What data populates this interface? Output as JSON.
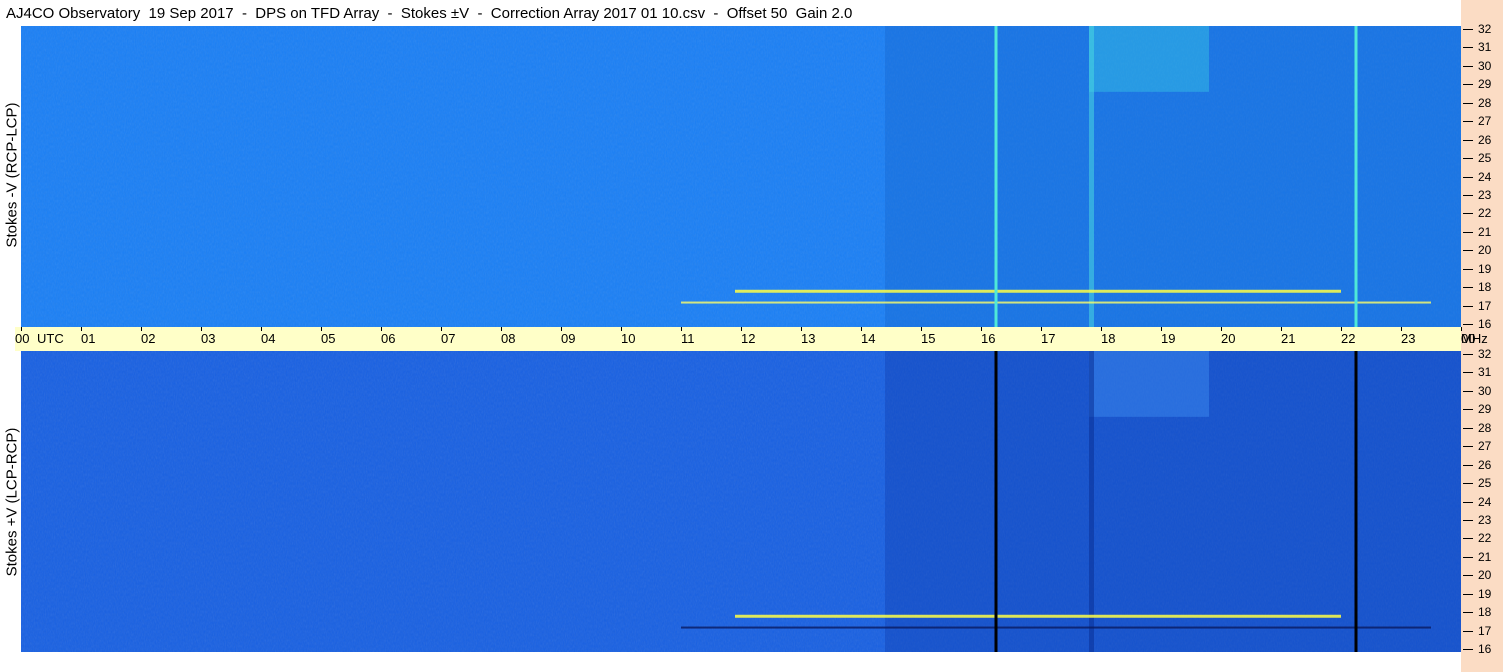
{
  "title": "AJ4CO Observatory  19 Sep 2017  -  DPS on TFD Array  -  Stokes ±V  -  Correction Array 2017 01 10.csv  -  Offset 50  Gain 2.0",
  "chart_data": [
    {
      "type": "heatmap",
      "name": "Stokes -V (RCP-LCP)",
      "ylabel": "Stokes -V (RCP-LCP)",
      "x_axis": "UTC",
      "y_axis_unit": "MHz",
      "xlim": [
        0,
        24
      ],
      "ylim": [
        16,
        32
      ],
      "colors": {
        "background": "#1a7ff5",
        "bright": "#ffff44",
        "streak": "#4fe8d8"
      },
      "vertical_streaks_utc": [
        16.25,
        22.25
      ],
      "bright_band_utc": [
        11.9,
        22.0
      ],
      "bright_band_mhz": 17.9
    },
    {
      "type": "heatmap",
      "name": "Stokes +V (LCP-RCP)",
      "ylabel": "Stokes +V (LCP-RCP)",
      "x_axis": "UTC",
      "y_axis_unit": "MHz",
      "xlim": [
        0,
        24
      ],
      "ylim": [
        16,
        32
      ],
      "colors": {
        "background": "#1860e2",
        "bright": "#ffff44",
        "streak": "#000000"
      },
      "vertical_streaks_utc": [
        16.25,
        22.25
      ],
      "bright_band_utc": [
        11.9,
        22.0
      ],
      "bright_band_mhz": 17.9
    }
  ],
  "time_axis": {
    "ticks": [
      "00",
      "01",
      "02",
      "03",
      "04",
      "05",
      "06",
      "07",
      "08",
      "09",
      "10",
      "11",
      "12",
      "13",
      "14",
      "15",
      "16",
      "17",
      "18",
      "19",
      "20",
      "21",
      "22",
      "23",
      "00"
    ],
    "utc_label": "UTC",
    "unit_label": "MHz"
  },
  "freq_axis": {
    "ticks": [
      "32",
      "31",
      "30",
      "29",
      "28",
      "27",
      "26",
      "25",
      "24",
      "23",
      "22",
      "21",
      "20",
      "19",
      "18",
      "17",
      "16"
    ]
  }
}
